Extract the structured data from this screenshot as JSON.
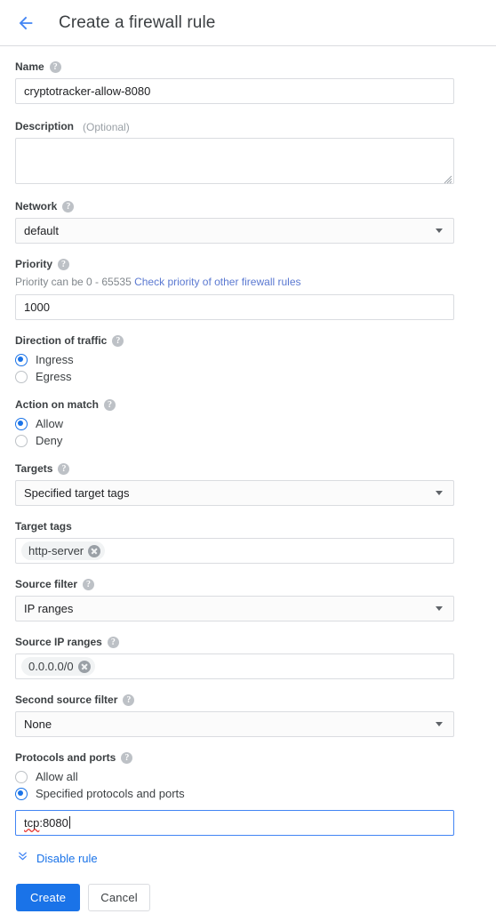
{
  "header": {
    "back_icon": "arrow-back-icon",
    "title": "Create a firewall rule"
  },
  "colors": {
    "accent": "#1a73e8",
    "link": "#5b79d1",
    "border": "#dadce0",
    "label": "#3c4043",
    "hint": "#80868b",
    "chip_bg": "#f1f3f4",
    "spellcheck": "#e53935"
  },
  "help_icon_glyph": "?",
  "fields": {
    "name": {
      "label": "Name",
      "help": "help-icon",
      "value": "cryptotracker-allow-8080"
    },
    "description": {
      "label": "Description",
      "optional": "(Optional)",
      "value": "",
      "placeholder": ""
    },
    "network": {
      "label": "Network",
      "help": "help-icon",
      "value": "default"
    },
    "priority": {
      "label": "Priority",
      "help": "help-icon",
      "hint": "Priority can be 0 - 65535",
      "link_text": "Check priority of other firewall rules",
      "value": "1000"
    },
    "direction": {
      "label": "Direction of traffic",
      "help": "help-icon",
      "options": [
        {
          "label": "Ingress",
          "checked": true
        },
        {
          "label": "Egress",
          "checked": false
        }
      ]
    },
    "action": {
      "label": "Action on match",
      "help": "help-icon",
      "options": [
        {
          "label": "Allow",
          "checked": true
        },
        {
          "label": "Deny",
          "checked": false
        }
      ]
    },
    "targets": {
      "label": "Targets",
      "help": "help-icon",
      "value": "Specified target tags"
    },
    "target_tags": {
      "label": "Target tags",
      "chips": [
        "http-server"
      ]
    },
    "source_filter": {
      "label": "Source filter",
      "help": "help-icon",
      "value": "IP ranges"
    },
    "source_ip_ranges": {
      "label": "Source IP ranges",
      "help": "help-icon",
      "chips": [
        "0.0.0.0/0"
      ]
    },
    "second_source_filter": {
      "label": "Second source filter",
      "help": "help-icon",
      "value": "None"
    },
    "protocols_and_ports": {
      "label": "Protocols and ports",
      "help": "help-icon",
      "options": [
        {
          "label": "Allow all",
          "checked": false
        },
        {
          "label": "Specified protocols and ports",
          "checked": true
        }
      ],
      "value_misspelled_part": "tcp",
      "value_rest": ":8080",
      "focused": true
    }
  },
  "expander": {
    "icon": "expand-more-double-icon",
    "label": "Disable rule"
  },
  "actions": {
    "create_label": "Create",
    "cancel_label": "Cancel"
  }
}
